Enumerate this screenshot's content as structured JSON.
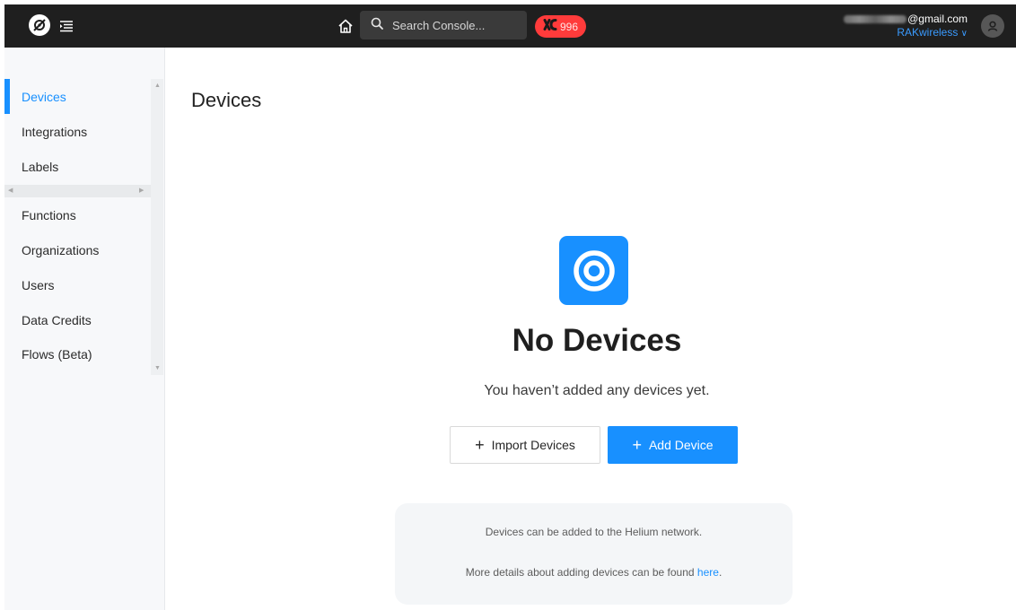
{
  "topbar": {
    "search_placeholder": "Search Console...",
    "data_credits": "996",
    "account_email_suffix": "@gmail.com",
    "organization": "RAKwireless",
    "organization_chevron": "∨"
  },
  "icons": {
    "logo": "helium-logo-icon",
    "menu": "menu-toggle-icon",
    "home": "home-icon",
    "search": "search-icon",
    "credits": "data-credits-icon",
    "avatar": "user-avatar-icon",
    "empty": "devices-target-icon"
  },
  "sidebar": {
    "items": [
      {
        "label": "Devices",
        "active": true
      },
      {
        "label": "Integrations"
      },
      {
        "label": "Labels"
      },
      {
        "label": "Functions"
      },
      {
        "label": "Organizations"
      },
      {
        "label": "Users"
      },
      {
        "label": "Data Credits"
      },
      {
        "label": "Flows (Beta)"
      }
    ]
  },
  "main": {
    "title": "Devices",
    "empty_title": "No Devices",
    "empty_subtitle": "You haven’t added any devices yet.",
    "import_button": "Import Devices",
    "add_button": "Add Device",
    "plus_glyph": "+",
    "info_line1": "Devices can be added to the Helium network.",
    "info_line2_prefix": "More details about adding devices can be found ",
    "info_link": "here",
    "info_line2_suffix": "."
  },
  "colors": {
    "accent": "#1890ff",
    "topbar": "#1f1f1f",
    "badge": "#ff3b3b"
  }
}
